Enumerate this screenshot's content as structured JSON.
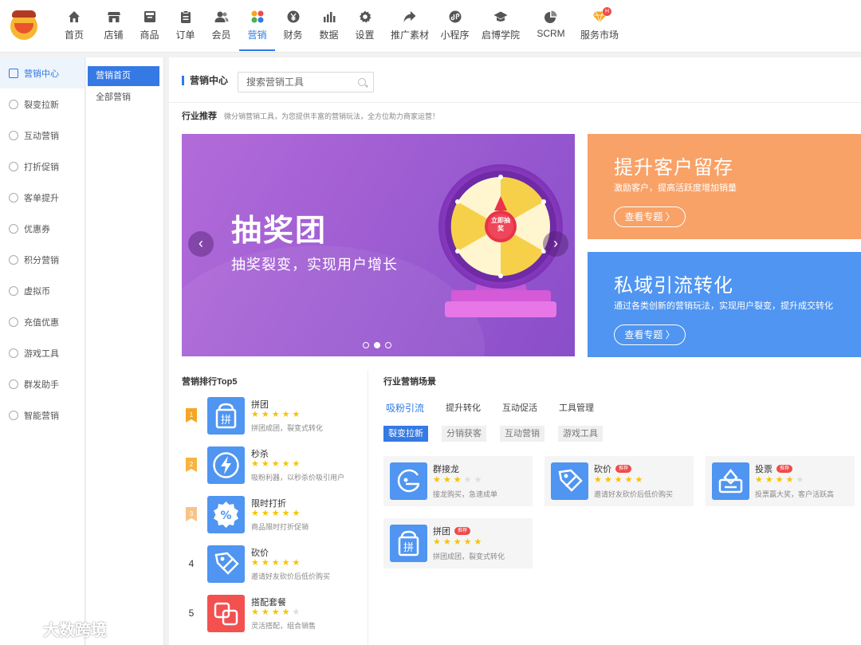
{
  "nav": {
    "items": [
      {
        "label": "首页",
        "icon": "home-icon"
      },
      {
        "label": "店铺",
        "icon": "store-icon"
      },
      {
        "label": "商品",
        "icon": "box-icon"
      },
      {
        "label": "订单",
        "icon": "clipboard-icon"
      },
      {
        "label": "会员",
        "icon": "members-icon"
      },
      {
        "label": "营销",
        "icon": "marketing-grid-icon",
        "active": true
      },
      {
        "label": "财务",
        "icon": "yen-icon"
      },
      {
        "label": "数据",
        "icon": "bar-chart-icon"
      },
      {
        "label": "设置",
        "icon": "gear-icon"
      },
      {
        "label": "推广素材",
        "icon": "share-icon"
      },
      {
        "label": "小程序",
        "icon": "miniprogram-icon"
      },
      {
        "label": "启博学院",
        "icon": "graduation-cap-icon"
      },
      {
        "label": "SCRM",
        "icon": "pie-chart-icon"
      },
      {
        "label": "服务市场",
        "icon": "diamond-icon",
        "badge": "H"
      }
    ]
  },
  "sidebar": {
    "items": [
      {
        "label": "营销中心",
        "active": true
      },
      {
        "label": "裂变拉新"
      },
      {
        "label": "互动营销"
      },
      {
        "label": "打折促销"
      },
      {
        "label": "客单提升"
      },
      {
        "label": "优惠券"
      },
      {
        "label": "积分营销"
      },
      {
        "label": "虚拟币"
      },
      {
        "label": "充值优惠"
      },
      {
        "label": "游戏工具"
      },
      {
        "label": "群发助手"
      },
      {
        "label": "智能营销"
      }
    ]
  },
  "subnav": {
    "items": [
      {
        "label": "营销首页",
        "active": true
      },
      {
        "label": "全部营销"
      }
    ]
  },
  "header": {
    "title": "营销中心",
    "search_placeholder": "搜索营销工具"
  },
  "recommend": {
    "title": "行业推荐",
    "desc": "微分销营销工具，为您提供丰富的营销玩法，全方位助力商家运营！"
  },
  "banner": {
    "title": "抽奖团",
    "subtitle": "抽奖裂变，实现用户增长",
    "wheel_center": "立即抽奖",
    "slide_count": 3,
    "active_slide": 2
  },
  "cards": [
    {
      "title": "提升客户留存",
      "desc": "激励客户，提高活跃度增加销量",
      "button": "查看专题 〉",
      "color": "#f8a268"
    },
    {
      "title": "私域引流转化",
      "desc": "通过各类创新的营销玩法，实现用户裂变，提升成交转化",
      "button": "查看专题 〉",
      "color": "#4f95f1"
    }
  ],
  "ranking": {
    "title": "营销排行Top5",
    "items": [
      {
        "rank": "1",
        "name": "拼团",
        "desc": "拼团成团，裂变式转化",
        "stars": 5,
        "icon": "group-buy-icon"
      },
      {
        "rank": "2",
        "name": "秒杀",
        "desc": "吸粉利器，以秒杀价吸引用户",
        "stars": 5,
        "icon": "lightning-icon"
      },
      {
        "rank": "3",
        "name": "限时打折",
        "desc": "商品限时打折促销",
        "stars": 5,
        "icon": "discount-badge-icon"
      },
      {
        "rank": "4",
        "name": "砍价",
        "desc": "邀请好友砍价后低价购买",
        "stars": 5,
        "icon": "price-tag-icon"
      },
      {
        "rank": "5",
        "name": "搭配套餐",
        "desc": "灵活搭配，组合销售",
        "stars": 4,
        "icon": "bundle-icon"
      }
    ]
  },
  "scene": {
    "title": "行业营销场景",
    "tabs": [
      "吸粉引流",
      "提升转化",
      "互动促活",
      "工具管理"
    ],
    "chips": [
      "裂变拉新",
      "分销获客",
      "互动营销",
      "游戏工具"
    ],
    "tag_label": "推荐",
    "cards": [
      {
        "name": "群接龙",
        "desc": "接龙购买，急速成单",
        "stars": 3,
        "tag": false,
        "icon": "relay-icon"
      },
      {
        "name": "砍价",
        "desc": "邀请好友砍价后低价购买",
        "stars": 5,
        "tag": true,
        "icon": "price-tag-icon"
      },
      {
        "name": "投票",
        "desc": "投票赢大奖，客户活跃高",
        "stars": 4,
        "tag": true,
        "icon": "vote-box-icon"
      },
      {
        "name": "拼团",
        "desc": "拼团成团，裂变式转化",
        "stars": 5,
        "tag": true,
        "icon": "group-buy-icon"
      }
    ]
  },
  "watermark": "大数跨境"
}
